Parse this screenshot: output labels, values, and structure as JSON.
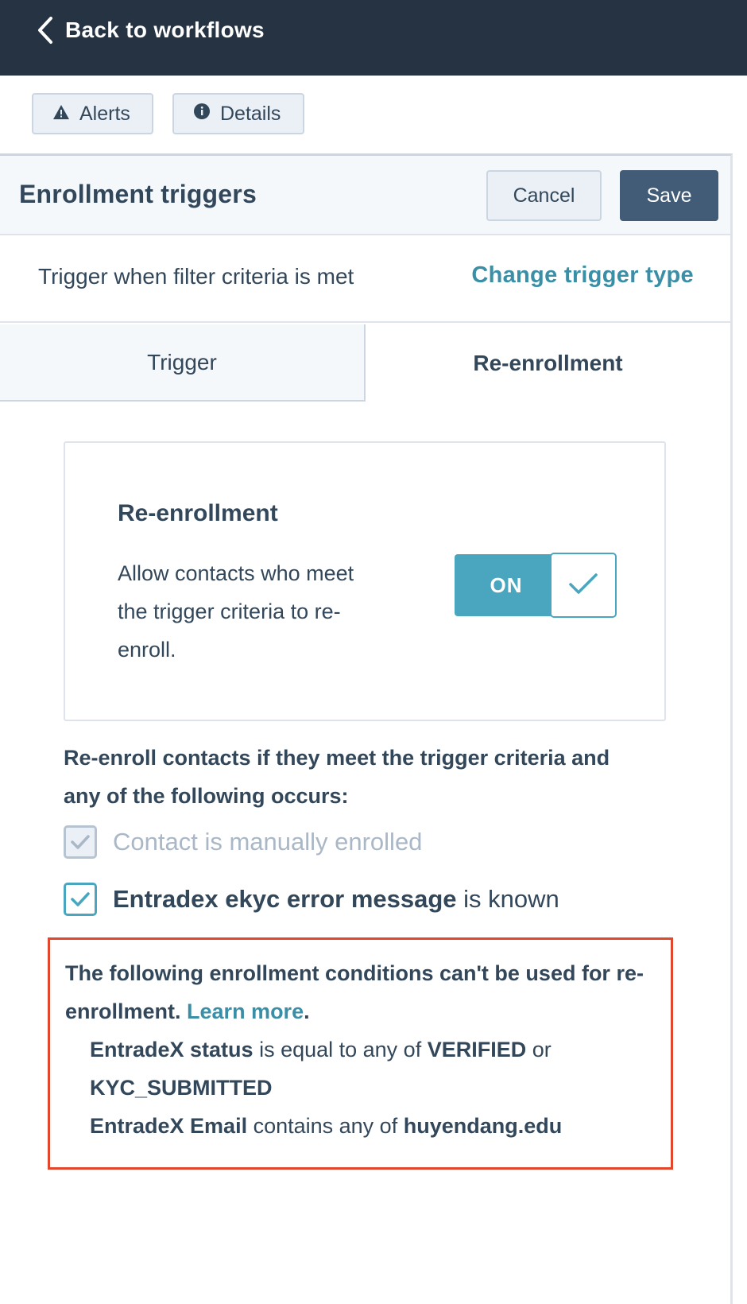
{
  "topbar": {
    "back_label": "Back to workflows",
    "background": "#253342"
  },
  "toolbar": {
    "alerts_label": "Alerts",
    "details_label": "Details"
  },
  "panel": {
    "title": "Enrollment triggers",
    "cancel_label": "Cancel",
    "save_label": "Save",
    "trigger_text": "Trigger when filter criteria is met",
    "change_trigger_label": "Change trigger type",
    "tabs": [
      {
        "label": "Trigger",
        "active": false
      },
      {
        "label": "Re-enrollment",
        "active": true
      }
    ]
  },
  "reenrollment_card": {
    "title": "Re-enrollment",
    "description": "Allow contacts who meet the trigger criteria to re-enroll.",
    "toggle_label": "ON",
    "toggle_state": true
  },
  "reenroll": {
    "description": "Re-enroll contacts if they meet the trigger criteria and any of the following occurs:",
    "options": [
      {
        "label": "Contact is manually enrolled",
        "checked": true,
        "disabled": true
      },
      {
        "property": "Entradex ekyc error message",
        "operator": " is known",
        "checked": true,
        "disabled": false
      }
    ]
  },
  "warning": {
    "text": "The following enrollment conditions can't be used for re-enrollment. ",
    "learn_more": "Learn more",
    "period": ".",
    "conditions": [
      {
        "property": "EntradeX status",
        "operator": " is equal to any of ",
        "value1": "VERIFIED",
        "joiner": " or ",
        "value2": "KYC_SUBMITTED"
      },
      {
        "property": "EntradeX Email",
        "operator": " contains any of ",
        "value1": "huyendang.edu"
      }
    ],
    "border_color": "#e0472d"
  },
  "colors": {
    "accent": "#4aa6bf",
    "link": "#3a8fa6",
    "text": "#33475b",
    "save_button": "#425b76"
  }
}
